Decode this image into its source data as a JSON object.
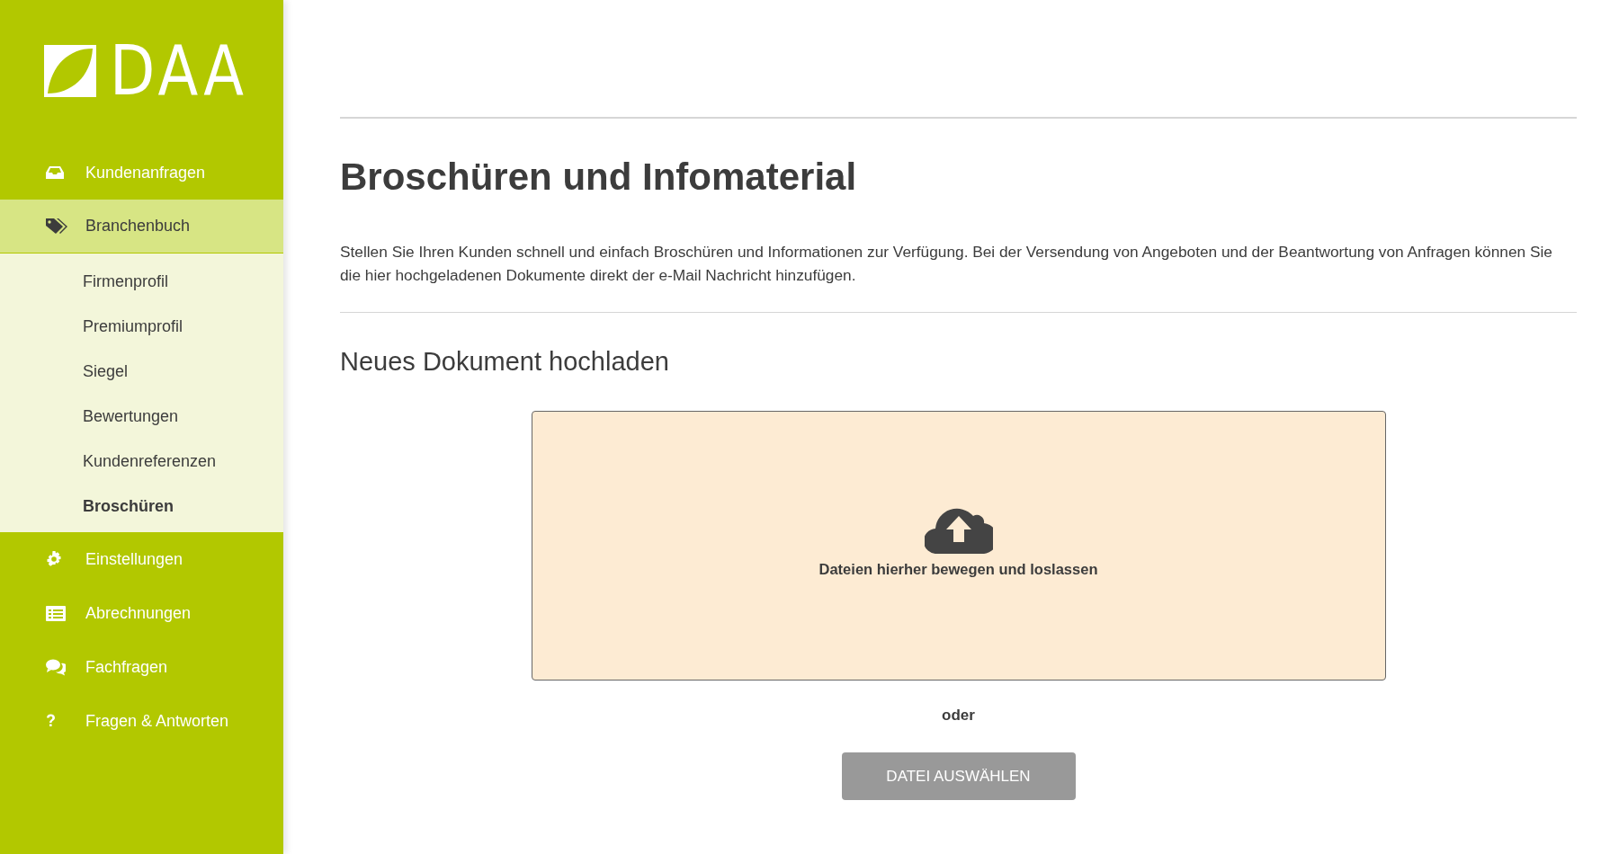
{
  "logo": {
    "text": "DAA"
  },
  "sidebar": {
    "items": [
      {
        "label": "Kundenanfragen",
        "selected": false
      },
      {
        "label": "Branchenbuch",
        "selected": true,
        "expanded": true,
        "children": [
          {
            "label": "Firmenprofil",
            "selected": false
          },
          {
            "label": "Premiumprofil",
            "selected": false
          },
          {
            "label": "Siegel",
            "selected": false
          },
          {
            "label": "Bewertungen",
            "selected": false
          },
          {
            "label": "Kundenreferenzen",
            "selected": false
          },
          {
            "label": "Broschüren",
            "selected": true
          }
        ]
      },
      {
        "label": "Einstellungen",
        "selected": false
      },
      {
        "label": "Abrechnungen",
        "selected": false
      },
      {
        "label": "Fachfragen",
        "selected": false
      },
      {
        "label": "Fragen & Antworten",
        "selected": false
      }
    ]
  },
  "main": {
    "title": "Broschüren und Infomaterial",
    "description": "Stellen Sie Ihren Kunden schnell und einfach Broschüren und Informationen zur Verfügung. Bei der Versendung von Angeboten und der Beantwortung von Anfragen können Sie die hier hochgeladenen Dokumente direkt der e-Mail Nachricht hinzufügen.",
    "upload": {
      "heading": "Neues Dokument hochladen",
      "dropzone_text": "Dateien hierher bewegen und loslassen",
      "separator": "oder",
      "button": "DATEI AUSWÄHLEN"
    }
  }
}
